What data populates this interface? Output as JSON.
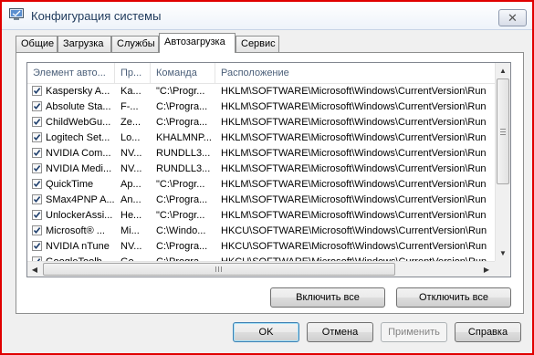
{
  "window": {
    "title": "Конфигурация системы"
  },
  "tabs": [
    {
      "label": "Общие"
    },
    {
      "label": "Загрузка"
    },
    {
      "label": "Службы"
    },
    {
      "label": "Автозагрузка"
    },
    {
      "label": "Сервис"
    }
  ],
  "active_tab": "Автозагрузка",
  "list": {
    "columns": [
      {
        "label": "Элемент авто..."
      },
      {
        "label": "Пр..."
      },
      {
        "label": "Команда"
      },
      {
        "label": "Расположение"
      }
    ],
    "rows": [
      {
        "checked": true,
        "item": "Kaspersky A...",
        "publisher": "Ka...",
        "command": "\"C:\\Progr...",
        "location": "HKLM\\SOFTWARE\\Microsoft\\Windows\\CurrentVersion\\Run"
      },
      {
        "checked": true,
        "item": "Absolute Sta...",
        "publisher": "F-...",
        "command": "C:\\Progra...",
        "location": "HKLM\\SOFTWARE\\Microsoft\\Windows\\CurrentVersion\\Run"
      },
      {
        "checked": true,
        "item": "ChildWebGu...",
        "publisher": "Ze...",
        "command": "C:\\Progra...",
        "location": "HKLM\\SOFTWARE\\Microsoft\\Windows\\CurrentVersion\\Run"
      },
      {
        "checked": true,
        "item": "Logitech Set...",
        "publisher": "Lo...",
        "command": "KHALMNP...",
        "location": "HKLM\\SOFTWARE\\Microsoft\\Windows\\CurrentVersion\\Run"
      },
      {
        "checked": true,
        "item": "NVIDIA Com...",
        "publisher": "NV...",
        "command": "RUNDLL3...",
        "location": "HKLM\\SOFTWARE\\Microsoft\\Windows\\CurrentVersion\\Run"
      },
      {
        "checked": true,
        "item": "NVIDIA Medi...",
        "publisher": "NV...",
        "command": "RUNDLL3...",
        "location": "HKLM\\SOFTWARE\\Microsoft\\Windows\\CurrentVersion\\Run"
      },
      {
        "checked": true,
        "item": "QuickTime",
        "publisher": "Ap...",
        "command": "\"C:\\Progr...",
        "location": "HKLM\\SOFTWARE\\Microsoft\\Windows\\CurrentVersion\\Run"
      },
      {
        "checked": true,
        "item": "SMax4PNP A...",
        "publisher": "An...",
        "command": "C:\\Progra...",
        "location": "HKLM\\SOFTWARE\\Microsoft\\Windows\\CurrentVersion\\Run"
      },
      {
        "checked": true,
        "item": "UnlockerAssi...",
        "publisher": "He...",
        "command": "\"C:\\Progr...",
        "location": "HKLM\\SOFTWARE\\Microsoft\\Windows\\CurrentVersion\\Run"
      },
      {
        "checked": true,
        "item": "Microsoft® ...",
        "publisher": "Mi...",
        "command": "C:\\Windo...",
        "location": "HKCU\\SOFTWARE\\Microsoft\\Windows\\CurrentVersion\\Run"
      },
      {
        "checked": true,
        "item": "NVIDIA nTune",
        "publisher": "NV...",
        "command": "C:\\Progra...",
        "location": "HKCU\\SOFTWARE\\Microsoft\\Windows\\CurrentVersion\\Run"
      },
      {
        "checked": true,
        "item": "GoogleToolb...",
        "publisher": "Go...",
        "command": "C:\\Progra...",
        "location": "HKCU\\SOFTWARE\\Microsoft\\Windows\\CurrentVersion\\Run"
      }
    ]
  },
  "buttons": {
    "enable_all": "Включить все",
    "disable_all": "Отключить все",
    "ok": "OK",
    "cancel": "Отмена",
    "apply": "Применить",
    "help": "Справка"
  },
  "icons": {
    "title": "system-config-icon",
    "close": "close-icon",
    "check": "checkmark-icon",
    "scroll_up": "arrow-up-icon",
    "scroll_down": "arrow-down-icon",
    "scroll_left": "arrow-left-icon",
    "scroll_right": "arrow-right-icon"
  },
  "colors": {
    "frame_highlight": "#e00000",
    "title_text": "#1e395b",
    "default_button_border": "#3c7fb1"
  }
}
